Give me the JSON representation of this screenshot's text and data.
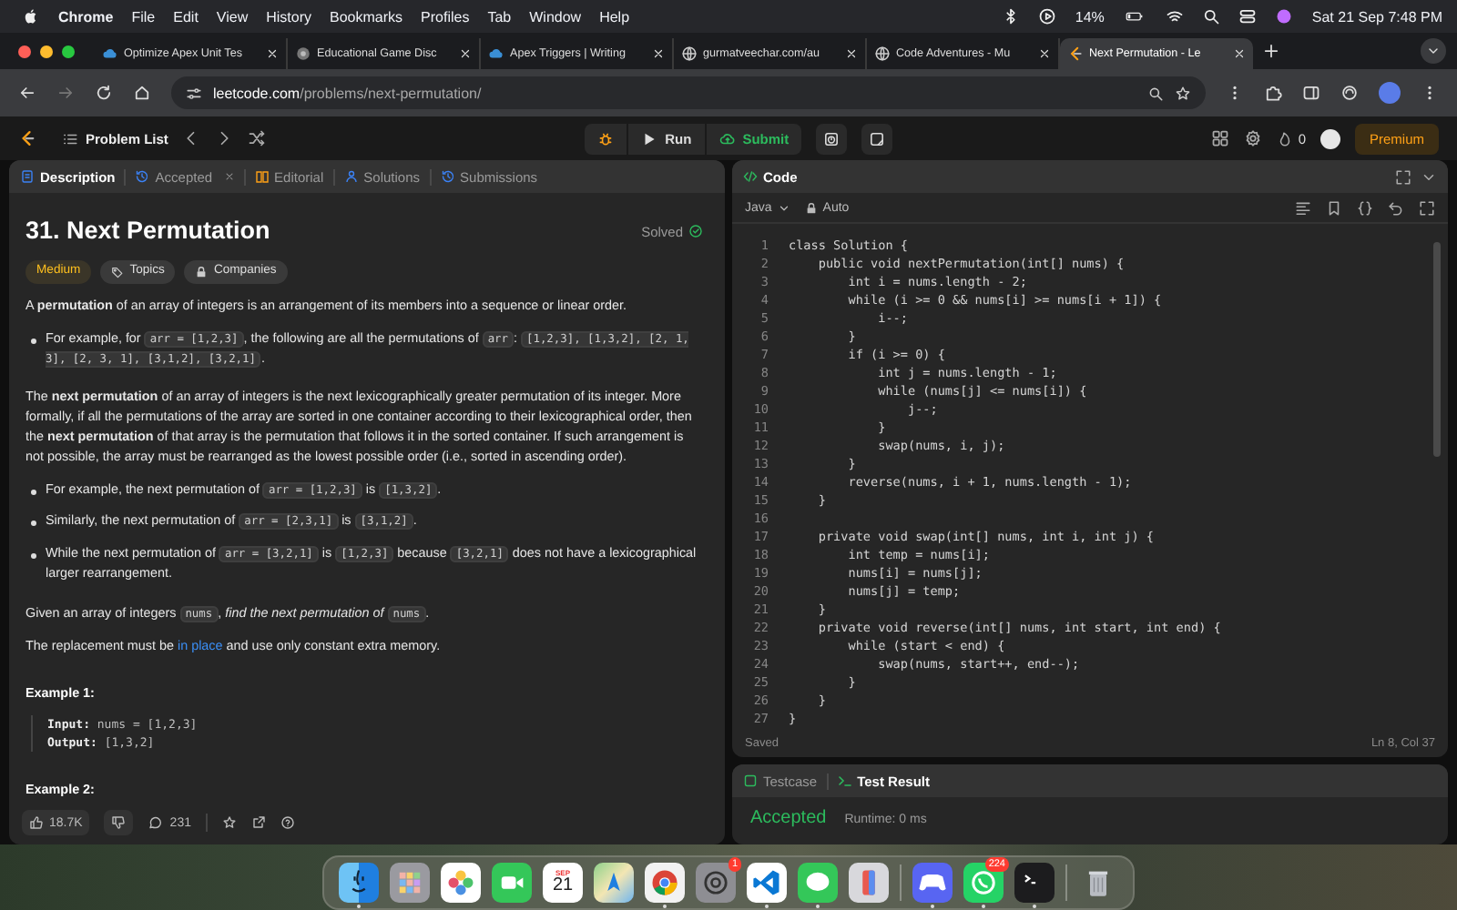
{
  "menu_bar": {
    "app": "Chrome",
    "menus": [
      "File",
      "Edit",
      "View",
      "History",
      "Bookmarks",
      "Profiles",
      "Tab",
      "Window",
      "Help"
    ],
    "battery_percent": "14%",
    "clock": "Sat 21 Sep  7:48 PM"
  },
  "browser": {
    "tabs": [
      {
        "title": "Optimize Apex Unit Tes",
        "selected": false
      },
      {
        "title": "Educational Game Disc",
        "selected": false
      },
      {
        "title": "Apex Triggers | Writing",
        "selected": false
      },
      {
        "title": "gurmatveechar.com/au",
        "selected": false
      },
      {
        "title": "Code Adventures - Mu",
        "selected": false
      },
      {
        "title": "Next Permutation - Le",
        "selected": true
      }
    ],
    "url_host": "leetcode.com",
    "url_path": "/problems/next-permutation/"
  },
  "nav": {
    "problem_list": "Problem List",
    "run": "Run",
    "submit": "Submit",
    "streak": "0",
    "premium": "Premium"
  },
  "description_panel": {
    "tabs": [
      {
        "label": "Description",
        "selected": true,
        "closable": false
      },
      {
        "label": "Accepted",
        "selected": false,
        "closable": true
      },
      {
        "label": "Editorial",
        "selected": false,
        "closable": false
      },
      {
        "label": "Solutions",
        "selected": false,
        "closable": false
      },
      {
        "label": "Submissions",
        "selected": false,
        "closable": false
      }
    ],
    "title": "31. Next Permutation",
    "status": "Solved",
    "difficulty": "Medium",
    "tags": [
      "Topics",
      "Companies"
    ],
    "blocks": [
      {
        "kind": "paragraph",
        "segments": [
          {
            "kind": "text",
            "text": "A **permutation** of an array of integers is an arrangement of its members into a sequence or linear order."
          }
        ]
      },
      {
        "kind": "bullets",
        "items": [
          [
            {
              "kind": "text",
              "text": "For example, for "
            },
            {
              "kind": "code",
              "text": "arr = [1,2,3]"
            },
            {
              "kind": "text",
              "text": ", the following are all the permutations of "
            },
            {
              "kind": "code",
              "text": "arr"
            },
            {
              "kind": "text",
              "text": ": "
            },
            {
              "kind": "code",
              "text": "[1,2,3], [1,3,2], [2, 1, 3], [2, 3, 1], [3,1,2], [3,2,1]"
            },
            {
              "kind": "text",
              "text": "."
            }
          ]
        ]
      },
      {
        "kind": "paragraph",
        "segments": [
          {
            "kind": "text",
            "text": "The **next permutation** of an array of integers is the next lexicographically greater permutation of its integer. More formally, if all the permutations of the array are sorted in one container according to their lexicographical order, then the **next permutation** of that array is the permutation that follows it in the sorted container. If such arrangement is not possible, the array must be rearranged as the lowest possible order (i.e., sorted in ascending order)."
          }
        ]
      },
      {
        "kind": "bullets",
        "items": [
          [
            {
              "kind": "text",
              "text": "For example, the next permutation of "
            },
            {
              "kind": "code",
              "text": "arr = [1,2,3]"
            },
            {
              "kind": "text",
              "text": " is "
            },
            {
              "kind": "code",
              "text": "[1,3,2]"
            },
            {
              "kind": "text",
              "text": "."
            }
          ],
          [
            {
              "kind": "text",
              "text": "Similarly, the next permutation of "
            },
            {
              "kind": "code",
              "text": "arr = [2,3,1]"
            },
            {
              "kind": "text",
              "text": " is "
            },
            {
              "kind": "code",
              "text": "[3,1,2]"
            },
            {
              "kind": "text",
              "text": "."
            }
          ],
          [
            {
              "kind": "text",
              "text": "While the next permutation of "
            },
            {
              "kind": "code",
              "text": "arr = [3,2,1]"
            },
            {
              "kind": "text",
              "text": " is "
            },
            {
              "kind": "code",
              "text": "[1,2,3]"
            },
            {
              "kind": "text",
              "text": " because "
            },
            {
              "kind": "code",
              "text": "[3,2,1]"
            },
            {
              "kind": "text",
              "text": " does not have a lexicographical larger rearrangement."
            }
          ]
        ]
      },
      {
        "kind": "paragraph",
        "segments": [
          {
            "kind": "text",
            "text": "Given an array of integers "
          },
          {
            "kind": "code",
            "text": "nums"
          },
          {
            "kind": "text",
            "text": ", *find the next permutation of* "
          },
          {
            "kind": "code",
            "text": "nums"
          },
          {
            "kind": "text",
            "text": "."
          }
        ]
      },
      {
        "kind": "paragraph",
        "segments": [
          {
            "kind": "text",
            "text": "The replacement must be "
          },
          {
            "kind": "link",
            "text": "in place"
          },
          {
            "kind": "text",
            "text": " and use only constant extra memory."
          }
        ]
      },
      {
        "kind": "heading",
        "text": "Example 1:"
      },
      {
        "kind": "example",
        "lines": [
          "**Input:** nums = [1,2,3]",
          "**Output:** [1,3,2]"
        ]
      },
      {
        "kind": "heading",
        "text": "Example 2:"
      }
    ],
    "likes": "18.7K",
    "comments": "231"
  },
  "code_panel": {
    "title": "Code",
    "language": "Java",
    "autosave": "Auto",
    "lines": [
      {
        "number": "1",
        "text": "class Solution {"
      },
      {
        "number": "2",
        "text": "    public void nextPermutation(int[] nums) {"
      },
      {
        "number": "3",
        "text": "        int i = nums.length - 2;"
      },
      {
        "number": "4",
        "text": "        while (i >= 0 && nums[i] >= nums[i + 1]) {"
      },
      {
        "number": "5",
        "text": "            i--;"
      },
      {
        "number": "6",
        "text": "        }"
      },
      {
        "number": "7",
        "text": "        if (i >= 0) {"
      },
      {
        "number": "8",
        "text": "            int j = nums.length - 1;"
      },
      {
        "number": "9",
        "text": "            while (nums[j] <= nums[i]) {"
      },
      {
        "number": "10",
        "text": "                j--;"
      },
      {
        "number": "11",
        "text": "            }"
      },
      {
        "number": "12",
        "text": "            swap(nums, i, j);"
      },
      {
        "number": "13",
        "text": "        }"
      },
      {
        "number": "14",
        "text": "        reverse(nums, i + 1, nums.length - 1);"
      },
      {
        "number": "15",
        "text": "    }"
      },
      {
        "number": "16"
      },
      {
        "number": "17",
        "text": "    private void swap(int[] nums, int i, int j) {"
      },
      {
        "number": "18",
        "text": "        int temp = nums[i];"
      },
      {
        "number": "19",
        "text": "        nums[i] = nums[j];"
      },
      {
        "number": "20",
        "text": "        nums[j] = temp;"
      },
      {
        "number": "21",
        "text": "    }"
      },
      {
        "number": "22",
        "text": "    private void reverse(int[] nums, int start, int end) {"
      },
      {
        "number": "23",
        "text": "        while (start < end) {"
      },
      {
        "number": "24",
        "text": "            swap(nums, start++, end--);"
      },
      {
        "number": "25",
        "text": "        }"
      },
      {
        "number": "26",
        "text": "    }"
      },
      {
        "number": "27",
        "text": "}"
      }
    ],
    "status": "Saved",
    "cursor": "Ln 8, Col 37"
  },
  "test_panel": {
    "tabs": [
      {
        "label": "Testcase",
        "selected": false
      },
      {
        "label": "Test Result",
        "selected": true
      }
    ],
    "verdict": "Accepted",
    "runtime": "Runtime: 0 ms"
  },
  "dock": {
    "groups": [
      [
        {
          "kind": "face",
          "running": true
        },
        {
          "kind": "grid",
          "running": false
        },
        {
          "kind": "flower",
          "running": false
        },
        {
          "kind": "camera",
          "running": false
        },
        {
          "kind": "calendar",
          "running": false,
          "month": "SEP",
          "day": "21"
        },
        {
          "kind": "map",
          "running": false
        },
        {
          "kind": "browser",
          "running": true
        },
        {
          "kind": "gear",
          "running": false,
          "badge": "1"
        },
        {
          "kind": "editor",
          "running": true
        },
        {
          "kind": "bubble",
          "running": true
        },
        {
          "kind": "phone",
          "running": false
        }
      ],
      [
        {
          "kind": "controller",
          "running": true
        },
        {
          "kind": "chat",
          "running": true,
          "badge": "224"
        },
        {
          "kind": "terminal",
          "running": true
        }
      ],
      [
        {
          "kind": "trash",
          "running": false
        }
      ]
    ]
  }
}
